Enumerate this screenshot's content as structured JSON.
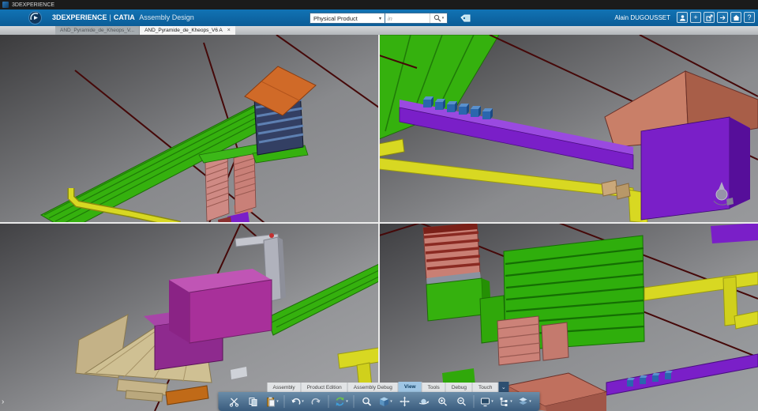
{
  "titlebar": {
    "title": "3DEXPERIENCE"
  },
  "header": {
    "brand": "3DEXPERIENCE",
    "divider": "|",
    "app": "CATIA",
    "module": "Assembly Design",
    "search": {
      "scope": "Physical Product",
      "caret": "▾",
      "placeholder": "in"
    },
    "user_name": "Alain DUGOUSSET",
    "add_label": "+",
    "help_label": "?",
    "icons": [
      "user",
      "add",
      "share",
      "open",
      "home",
      "help",
      "search",
      "tag",
      "compass-logo"
    ]
  },
  "doc_tabs": {
    "tab1": "AND_Pyramide_de_Kheops_V...",
    "tab2": "AND_Pyramide_de_Kheops_V6 A",
    "close": "×"
  },
  "action_bar": {
    "tabs": {
      "assembly": "Assembly",
      "product_edition": "Product Edition",
      "assembly_debug": "Assembly Debug",
      "view": "View",
      "tools": "Tools",
      "debug": "Debug",
      "touch": "Touch"
    },
    "active_tab": "View",
    "collapse": "⌄",
    "toolbar_icons": [
      "cut",
      "copy",
      "paste",
      "undo",
      "redo",
      "update",
      "fit-all",
      "view-cube",
      "pan",
      "orbit",
      "zoom-in",
      "zoom-out",
      "screen",
      "tree",
      "layers"
    ]
  },
  "viewport": {
    "layout": "quad",
    "model_colors": {
      "green": "#35b10e",
      "yellow": "#d8d822",
      "purple": "#7a1fc8",
      "magenta": "#b03898",
      "salmon": "#cf8a84",
      "orange": "#d06a28",
      "tan": "#cdbb8e",
      "cable_red": "#450808"
    }
  },
  "colors": {
    "header_blue": "#0f6cad",
    "titlebar": "#1b1b1b",
    "toolbar_blue": "#4a6d8e",
    "active_tab_blue": "#9fc6e4"
  }
}
